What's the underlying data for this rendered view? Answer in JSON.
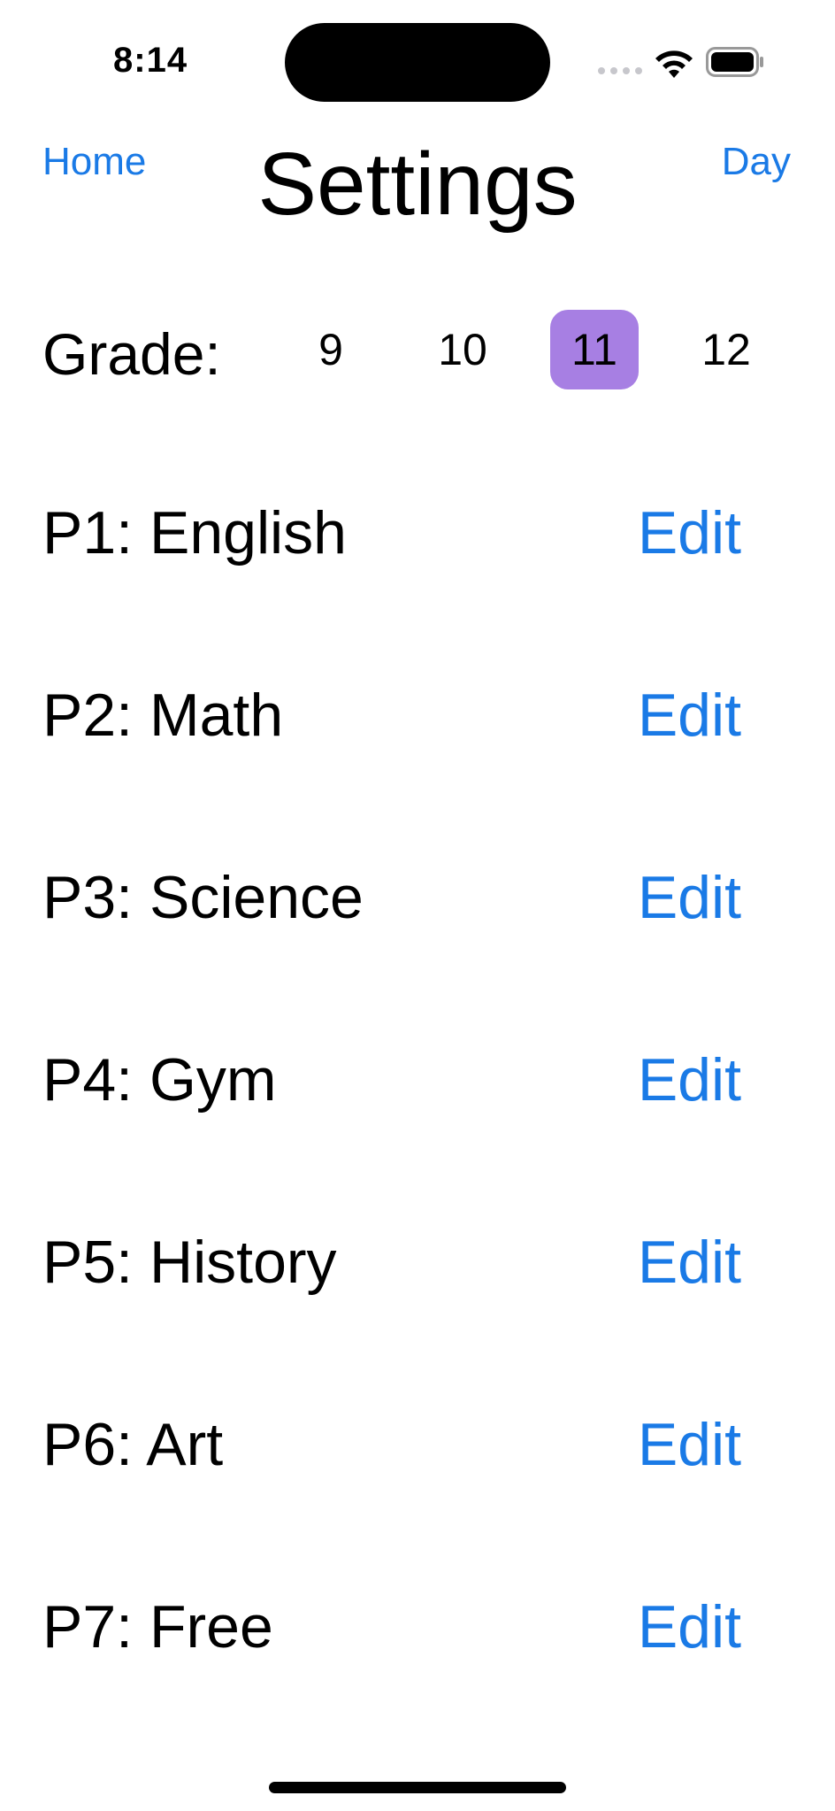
{
  "status_bar": {
    "time": "8:14",
    "wifi_icon": "wifi-icon",
    "battery_icon": "battery-icon"
  },
  "nav": {
    "home_label": "Home",
    "day_label": "Day",
    "title": "Settings"
  },
  "grade": {
    "label": "Grade:",
    "options": [
      "9",
      "10",
      "11",
      "12"
    ],
    "selected": "11",
    "selected_color": "#a77fe3"
  },
  "periods": [
    {
      "label": "P1: English",
      "edit": "Edit"
    },
    {
      "label": "P2: Math",
      "edit": "Edit"
    },
    {
      "label": "P3: Science",
      "edit": "Edit"
    },
    {
      "label": "P4: Gym",
      "edit": "Edit"
    },
    {
      "label": "P5: History",
      "edit": "Edit"
    },
    {
      "label": "P6: Art",
      "edit": "Edit"
    },
    {
      "label": "P7: Free",
      "edit": "Edit"
    }
  ],
  "colors": {
    "accent": "#1a7ae6",
    "text": "#000000",
    "background": "#ffffff"
  }
}
